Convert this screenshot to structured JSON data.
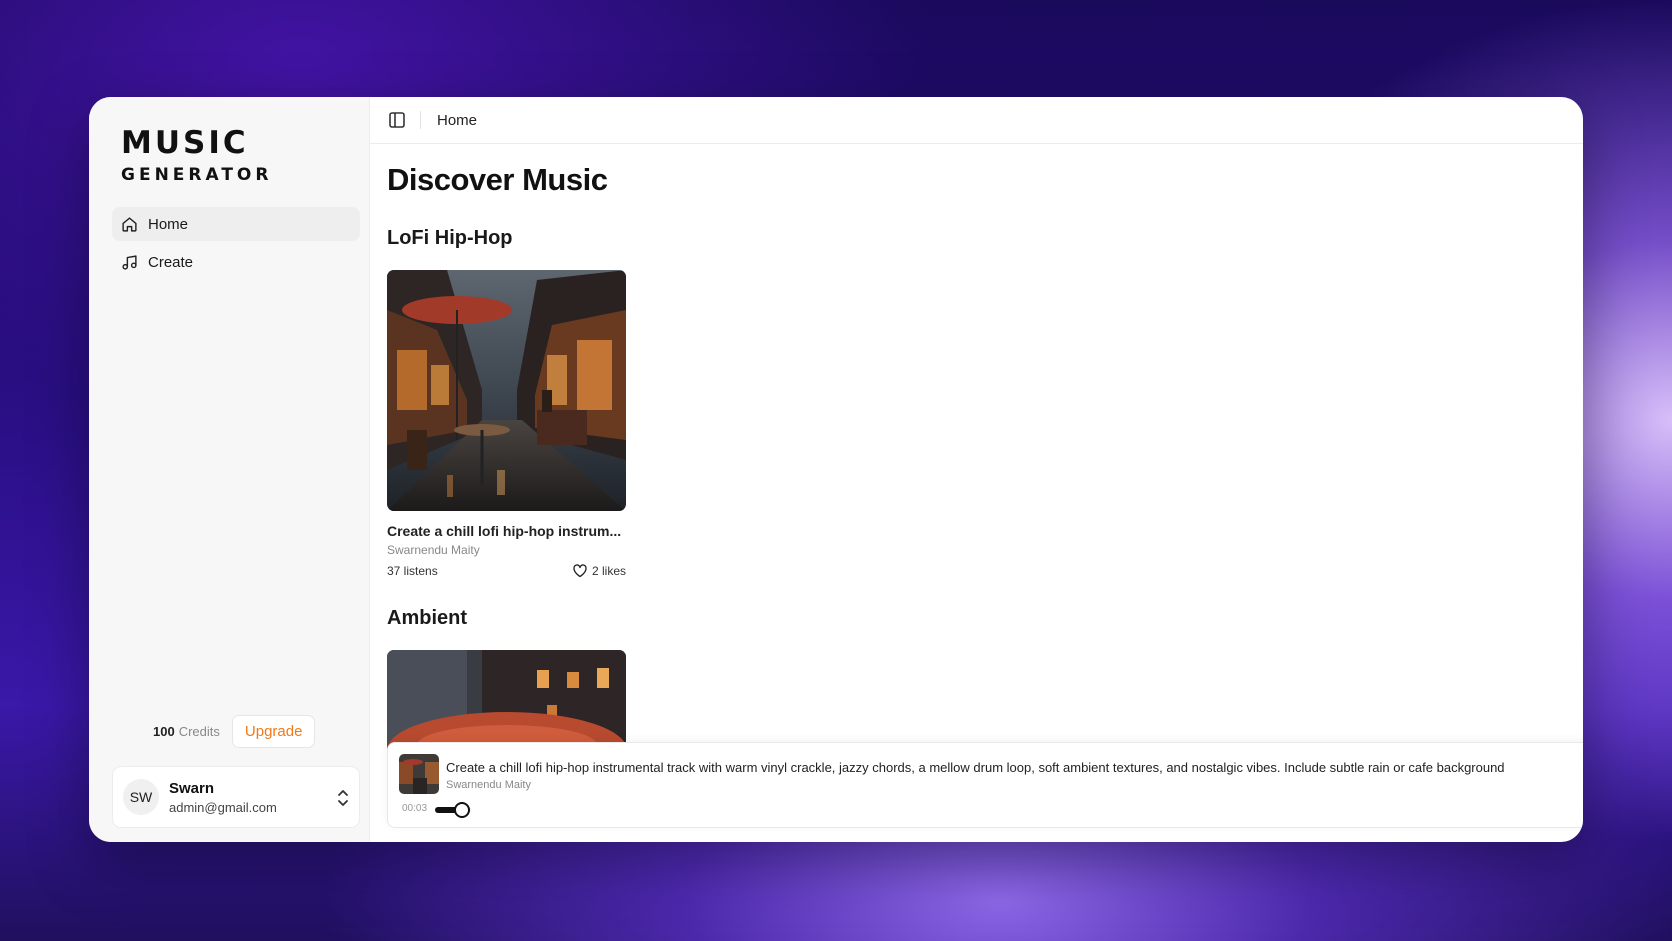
{
  "app": {
    "logo_line1": "MUSIC",
    "logo_line2": "GENERATOR"
  },
  "sidebar": {
    "items": [
      {
        "label": "Home",
        "icon": "home-icon",
        "active": true
      },
      {
        "label": "Create",
        "icon": "music-note-icon",
        "active": false
      }
    ],
    "credits_value": "100",
    "credits_label": "Credits",
    "upgrade_label": "Upgrade",
    "user": {
      "initials": "SW",
      "name": "Swarn",
      "email": "admin@gmail.com"
    }
  },
  "topbar": {
    "breadcrumb": "Home",
    "toggle_icon": "sidebar-toggle-icon"
  },
  "main": {
    "title": "Discover Music",
    "sections": [
      {
        "title": "LoFi Hip-Hop",
        "tracks": [
          {
            "title": "Create a chill lofi hip-hop instrum...",
            "artist": "Swarnendu Maity",
            "listens": "37 listens",
            "likes": "2 likes"
          }
        ]
      },
      {
        "title": "Ambient",
        "tracks": []
      }
    ]
  },
  "player": {
    "title": "Create a chill lofi hip-hop instrumental track with warm vinyl crackle, jazzy chords, a mellow drum loop, soft ambient textures, and nostalgic vibes. Include subtle rain or cafe background",
    "artist": "Swarnendu Maity",
    "time": "00:03",
    "progress": 0.75
  },
  "colors": {
    "accent": "#f07a1a",
    "text": "#111111"
  }
}
